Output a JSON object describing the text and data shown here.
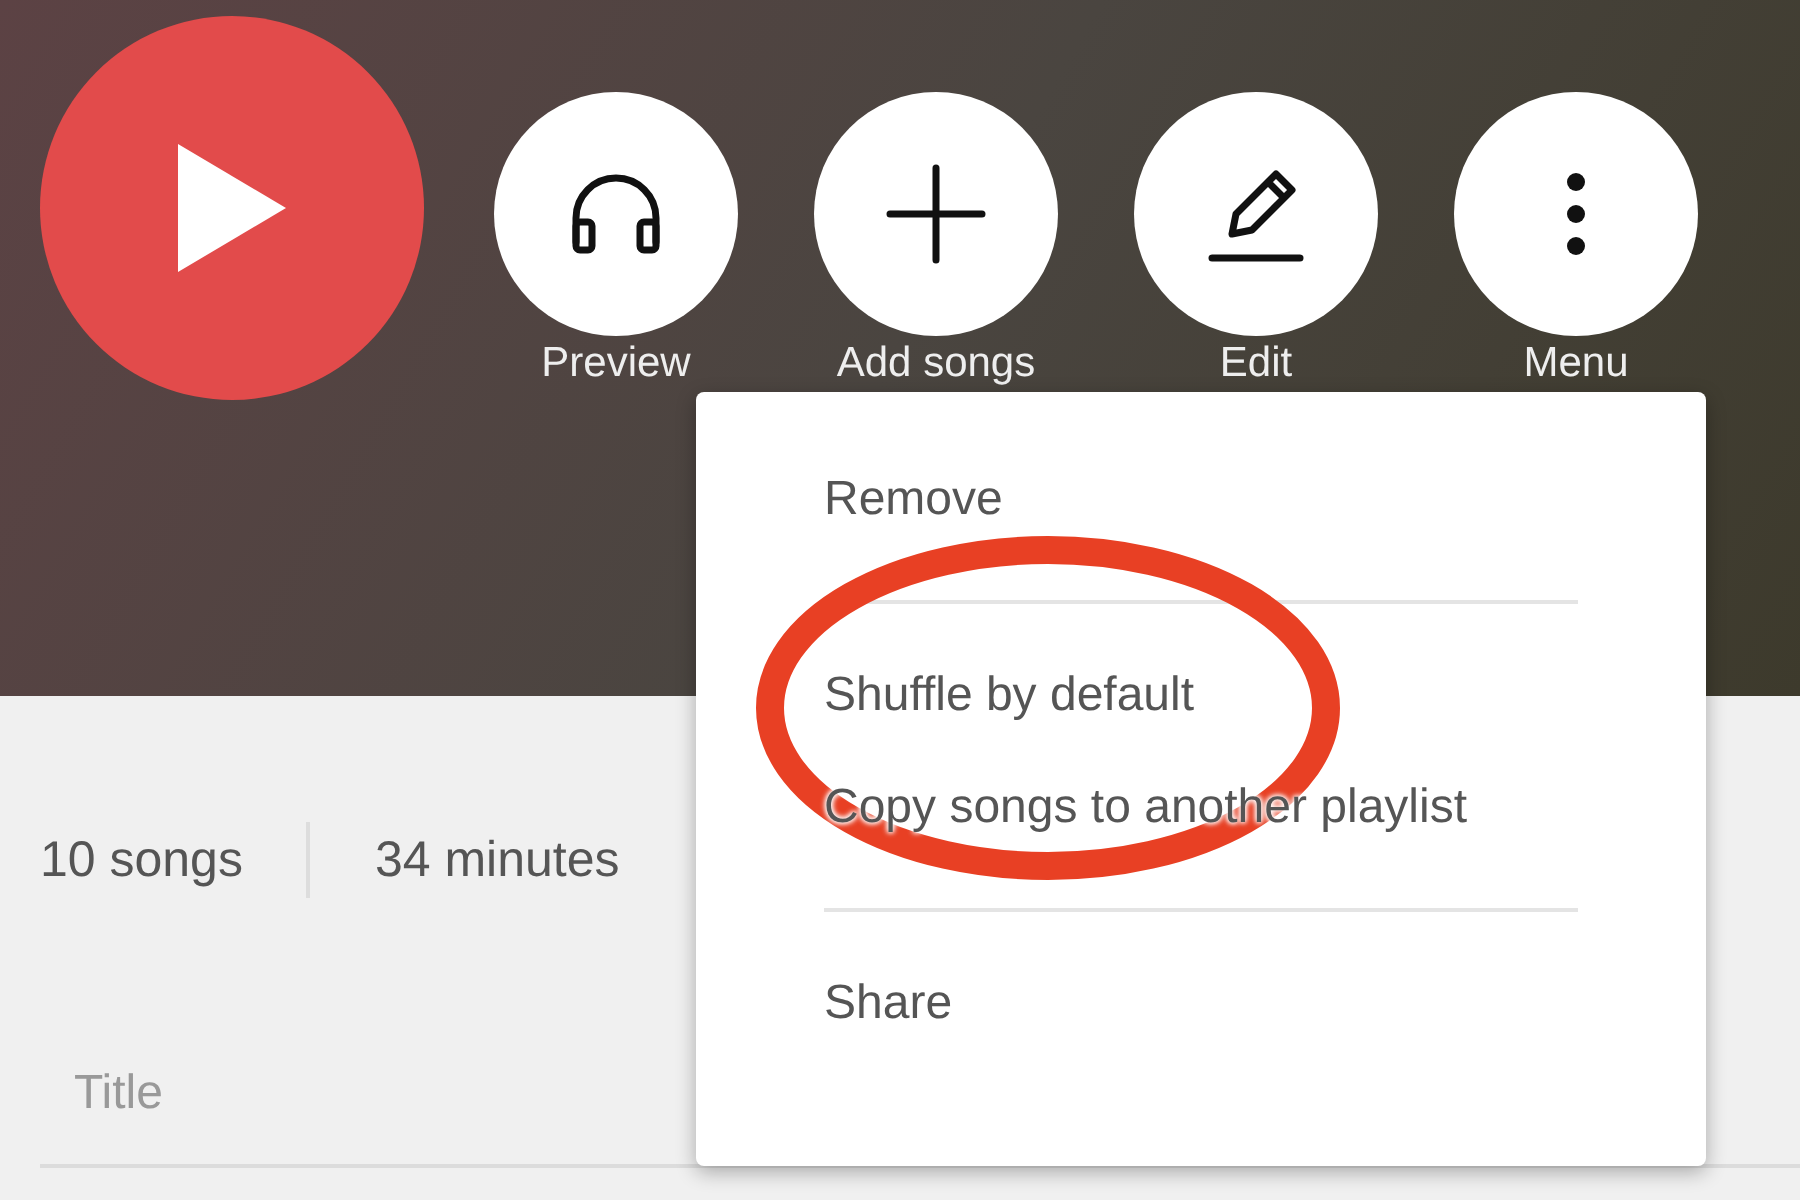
{
  "header": {
    "play_button": {
      "kind": "play"
    },
    "actions": [
      {
        "label": "Preview"
      },
      {
        "label": "Add songs"
      },
      {
        "label": "Edit"
      },
      {
        "label": "Menu"
      }
    ]
  },
  "menu": {
    "items": [
      {
        "label": "Remove",
        "divider_after": true
      },
      {
        "label": "Shuffle by default",
        "divider_after": false
      },
      {
        "label": "Copy songs to another playlist",
        "divider_after": true
      },
      {
        "label": "Share",
        "divider_after": false
      }
    ]
  },
  "highlight": {
    "kind": "ellipse",
    "color": "#e84024"
  },
  "summary": [
    "10 songs",
    "34 minutes"
  ],
  "table": {
    "columns": [
      "Title"
    ]
  }
}
